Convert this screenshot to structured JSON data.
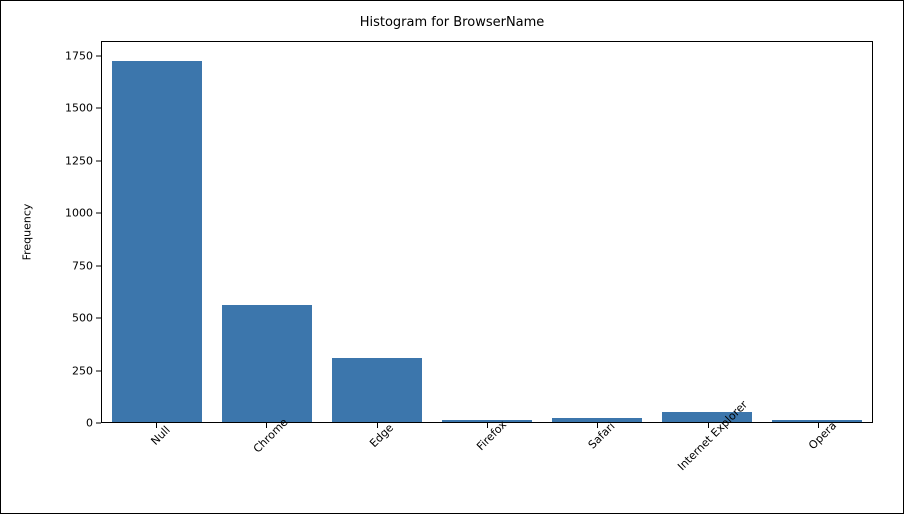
{
  "chart_data": {
    "type": "bar",
    "title": "Histogram for BrowserName",
    "xlabel": "",
    "ylabel": "Frequency",
    "categories": [
      "Null",
      "Chrome",
      "Edge",
      "Firefox",
      "Safari",
      "Internet Explorer",
      "Opera"
    ],
    "values": [
      1730,
      560,
      305,
      12,
      20,
      50,
      10
    ],
    "yticks": [
      0,
      250,
      500,
      750,
      1000,
      1250,
      1500,
      1750
    ],
    "ylim": [
      0,
      1820
    ]
  }
}
